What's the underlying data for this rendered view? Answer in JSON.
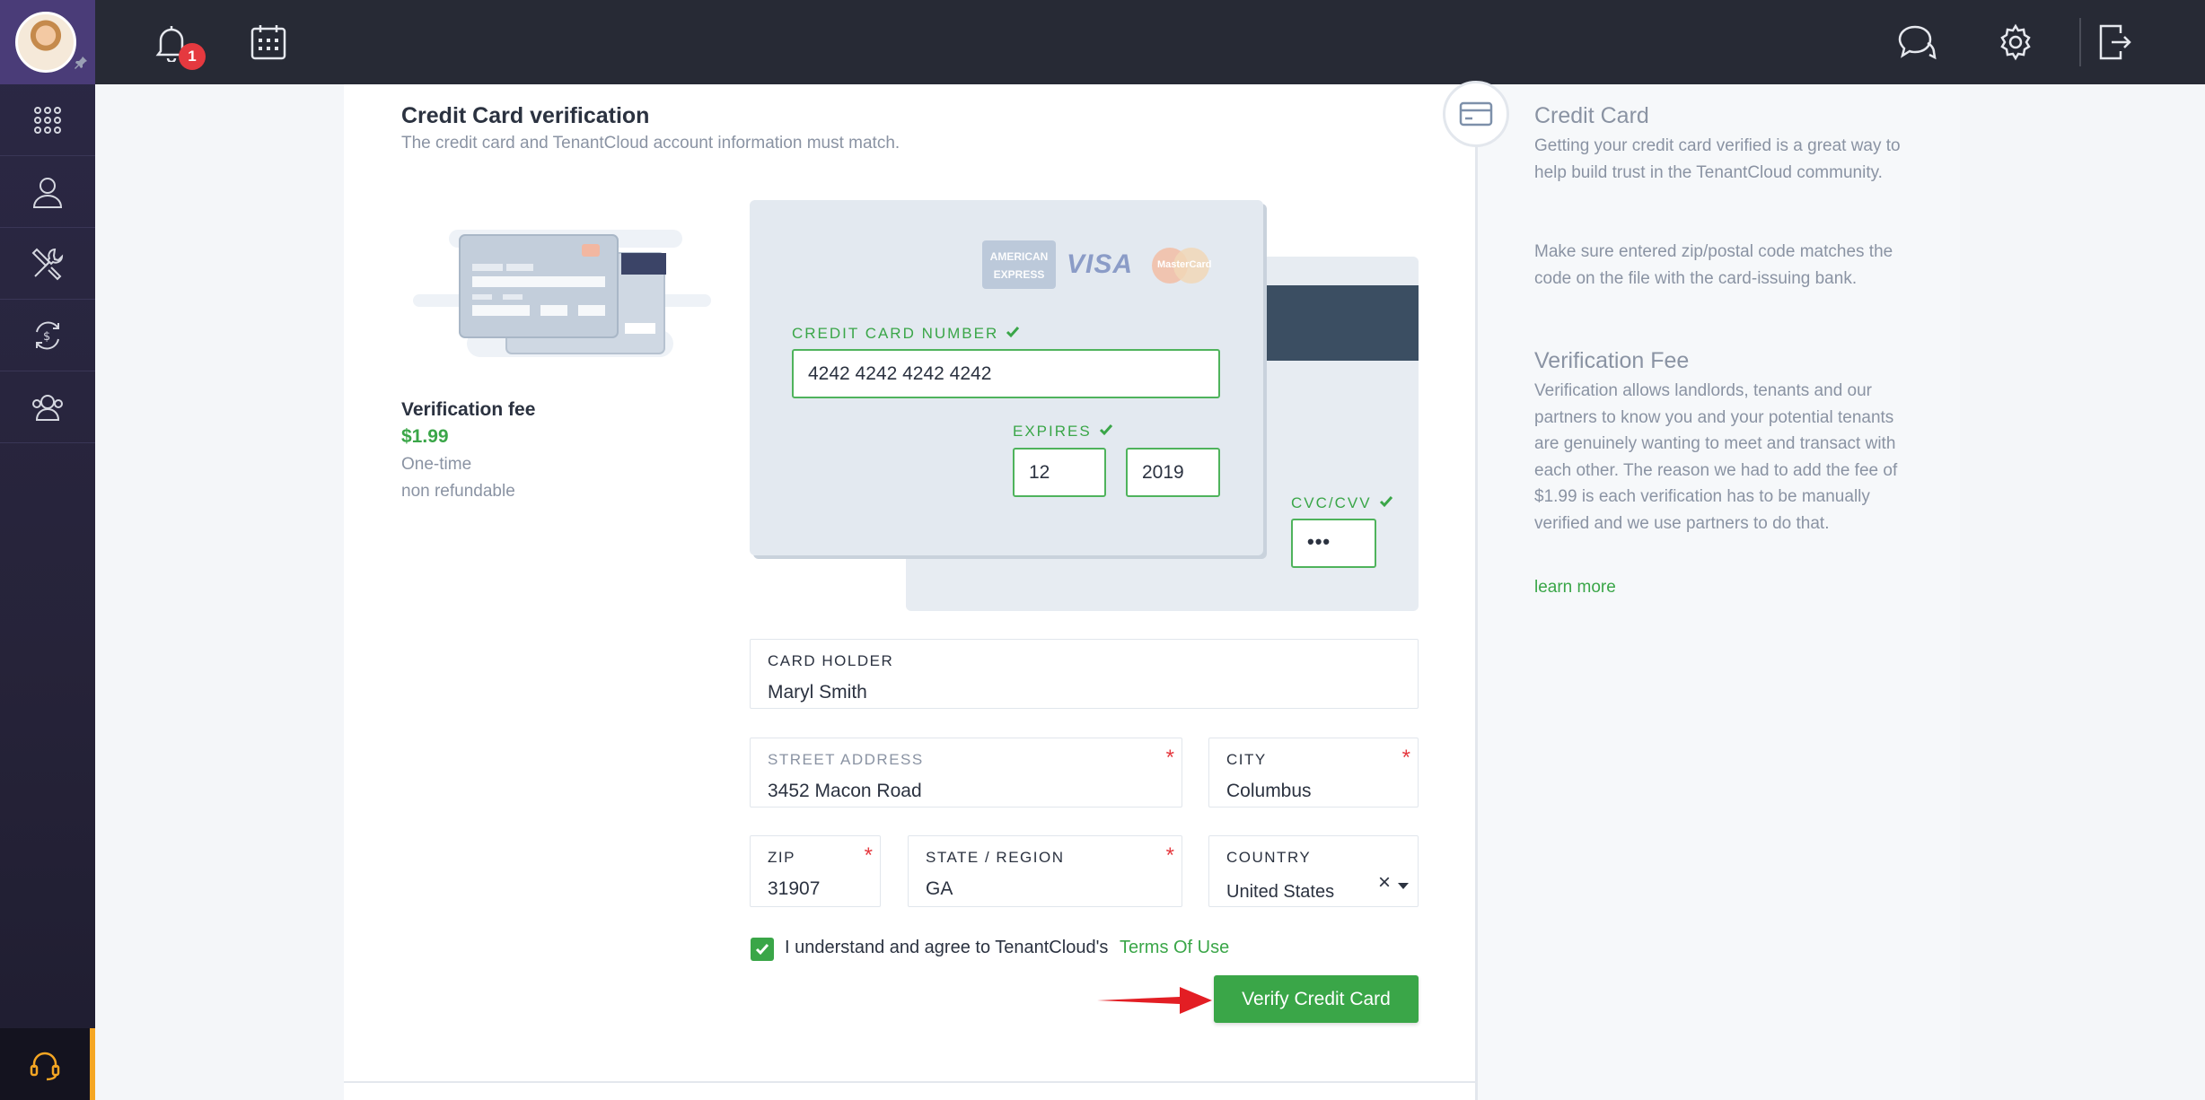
{
  "topbar": {
    "notification_count": "1"
  },
  "page": {
    "title": "Credit Card verification",
    "subtitle": "The credit card and TenantCloud account information must match."
  },
  "fee": {
    "title": "Verification fee",
    "price": "$1.99",
    "note1": "One-time",
    "note2": "non refundable"
  },
  "card": {
    "brands": [
      "AMERICAN EXPRESS",
      "VISA",
      "MasterCard"
    ],
    "number_label": "CREDIT CARD NUMBER",
    "number_value": "4242 4242 4242 4242",
    "expires_label": "EXPIRES",
    "exp_month": "12",
    "exp_year": "2019",
    "cvc_label": "CVC/CVV",
    "cvc_value": "•••"
  },
  "form": {
    "holder_label": "CARD HOLDER",
    "holder_value": "Maryl Smith",
    "street_label": "STREET ADDRESS",
    "street_value": "3452 Macon Road",
    "city_label": "CITY",
    "city_value": "Columbus",
    "zip_label": "ZIP",
    "zip_value": "31907",
    "state_label": "STATE / REGION",
    "state_value": "GA",
    "country_label": "COUNTRY",
    "country_value": "United States",
    "required_mark": "*",
    "agree_text": "I understand and agree to TenantCloud's",
    "agree_link": "Terms Of Use",
    "verify_button": "Verify Credit Card"
  },
  "info": {
    "cc_heading": "Credit Card",
    "cc_p1": "Getting your credit card verified is a great way to help build trust in the TenantCloud community.",
    "cc_p2": "Make sure entered zip/postal code matches the code on the file with the card-issuing bank.",
    "fee_heading": "Verification Fee",
    "fee_p": "Verification allows landlords, tenants and our partners to know you and your potential tenants are genuinely wanting to meet and transact with each other. The reason we had to add the fee of $1.99 is each verification has to be manually verified and we use partners to do that.",
    "learn_more": "learn more"
  },
  "colors": {
    "accent_green": "#3aa648",
    "sidebar_bg": "#262339",
    "topbar_bg": "#272a35",
    "required_red": "#e5393f",
    "support_orange": "#f5a623"
  },
  "icons": {
    "sidebar": [
      "apps-grid-icon",
      "user-icon",
      "tools-icon",
      "money-exchange-icon",
      "people-icon",
      "headset-icon"
    ],
    "topbar": [
      "bell-icon",
      "calendar-icon",
      "chat-icon",
      "gear-icon",
      "logout-icon"
    ]
  }
}
